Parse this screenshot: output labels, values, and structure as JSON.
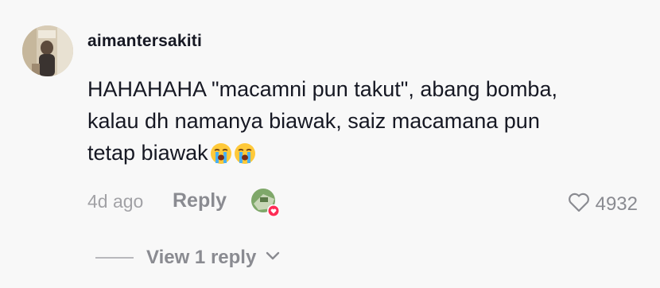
{
  "comment": {
    "username": "aimantersakiti",
    "text_lines": [
      "HAHAHAHA \"macamni pun takut\", abang bomba,",
      "kalau dh namanya biawak, saiz macamana pun",
      "tetap biawak"
    ],
    "emojis": [
      "loudly-crying-face",
      "loudly-crying-face"
    ],
    "timestamp": "4d ago",
    "reply_label": "Reply",
    "like_count": "4932",
    "view_replies_label": "View 1 reply"
  },
  "icons": {
    "heart": "heart-outline-icon",
    "chevron": "chevron-down-icon",
    "creator_liked_badge": "red-heart-badge-icon"
  },
  "colors": {
    "background": "#f8f8f8",
    "text_primary": "#161823",
    "text_secondary": "#8a8b91",
    "timestamp": "#a2a2a6",
    "badge_red": "#fe2c55"
  }
}
